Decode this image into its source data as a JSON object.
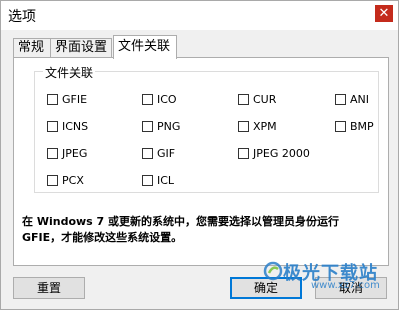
{
  "window": {
    "title": "选项",
    "close_symbol": "✕"
  },
  "tabs": [
    {
      "label": "常规",
      "active": false
    },
    {
      "label": "界面设置",
      "active": false
    },
    {
      "label": "文件关联",
      "active": true
    }
  ],
  "group": {
    "title": "文件关联",
    "items": [
      {
        "label": "GFIE",
        "checked": false
      },
      {
        "label": "ICO",
        "checked": false
      },
      {
        "label": "CUR",
        "checked": false
      },
      {
        "label": "ANI",
        "checked": false
      },
      {
        "label": "ICNS",
        "checked": false
      },
      {
        "label": "PNG",
        "checked": false
      },
      {
        "label": "XPM",
        "checked": false
      },
      {
        "label": "BMP",
        "checked": false
      },
      {
        "label": "JPEG",
        "checked": false
      },
      {
        "label": "GIF",
        "checked": false
      },
      {
        "label": "JPEG 2000",
        "checked": false
      },
      {
        "label": "PCX",
        "checked": false
      },
      {
        "label": "ICL",
        "checked": false
      }
    ]
  },
  "note": {
    "line1": "在 Windows 7 或更新的系统中，您需要选择以管理员身份运行",
    "line2": "GFIE，才能修改这些系统设置。"
  },
  "buttons": {
    "reset": "重置",
    "ok": "确定",
    "cancel": "取消"
  },
  "watermark": {
    "text": "极光下载站",
    "url": "www.xz7.com",
    "color": "#2a7fc9"
  }
}
